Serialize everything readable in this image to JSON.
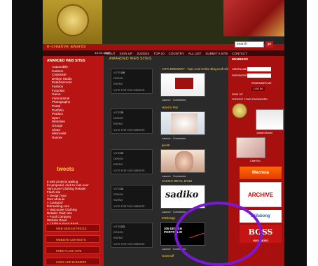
{
  "site": {
    "title": "e-creative awards",
    "date": "",
    "time": "13.01.2009"
  },
  "search": {
    "placeholder": "search",
    "go": "go"
  },
  "nav": [
    "about",
    "sign up",
    "judges",
    "top 10",
    "country",
    "all list",
    "submit a site",
    "contact"
  ],
  "left": {
    "categories_heading": "AWARDED WEB SITES",
    "categories": [
      "Automobile",
      "Cartoon",
      "Corporate",
      "Design Studio",
      "Entertainment",
      "Fashion",
      "Futuristic",
      "Game",
      "International",
      "Photography",
      "Portal",
      "Portfolio",
      "Product",
      "Sport",
      "Websites",
      "Grunge",
      "Clean",
      "Minimalist",
      "Runner"
    ],
    "tweets_heading": "tweets",
    "tweets": [
      "8 web projects waiting",
      "for proposal. click to look over",
      "Vancouver Clothing Retailer",
      "Flash site",
      "» Design Your",
      "Own Module",
      "» Contacts/",
      "fehmarking.com",
      "» Vancouver Clothing",
      "Retailer Flash site",
      "» Food Company",
      "Website Read",
      "» Clothing Store Read",
      "» Blood Gogs",
      "The Movie Read"
    ],
    "buttons": [
      "WEB DESIGN PRICES",
      "WEBSITE CONTESTS",
      "FREE FLASH SITE",
      "LINKS AND BANNERS"
    ]
  },
  "center": {
    "heading": "AWARDED WEB SITES",
    "entries": [
      {
        "votes": "108",
        "name": "TAPS BREWERY - Taps Cool Online Blog,Craft Site",
        "launch": "Launch",
        "comments": "Comments"
      },
      {
        "votes": "25",
        "name": "Hotel In Pair",
        "launch": "Launch",
        "comments": "Comments"
      },
      {
        "votes": "22",
        "name": "pixel8",
        "launch": "Launch",
        "comments": "Comments"
      },
      {
        "votes": "24",
        "name": "SADIKO METAL BAND",
        "launch": "Launch",
        "comments": "Comments"
      },
      {
        "votes": "223",
        "name": "305design",
        "launch": "Launch",
        "comments": "Comments"
      }
    ],
    "labels": {
      "votes": "VOTE",
      "design": "DESIGN",
      "rating": "RATING",
      "details": "VOTE FOR THIS WEBSITE"
    },
    "last": "Granmoff",
    "thumb_texts": {
      "sadiko": "sadiko",
      "portfolio": "305 DESIGN PORTFOLIO"
    }
  },
  "right": {
    "login": "MEMBERS",
    "username": "USERNAME",
    "password": "PASSWORD",
    "remember": "REMEMBER ME",
    "login_btn": "LOG IN",
    "signup": "SIGN UP",
    "forgot": "FORGOT YOUR PASSWORD",
    "winners": [
      "Jordan Brand",
      "Cafe Klo"
    ],
    "ads": [
      "Mecmua",
      "ARCHIVE",
      "Billabong",
      "BOSS"
    ],
    "boss_sub": "HUGO BOSS"
  },
  "colors": {
    "red": "#b81414",
    "gold": "#ffcc33",
    "annotation": "#7a18d8"
  }
}
